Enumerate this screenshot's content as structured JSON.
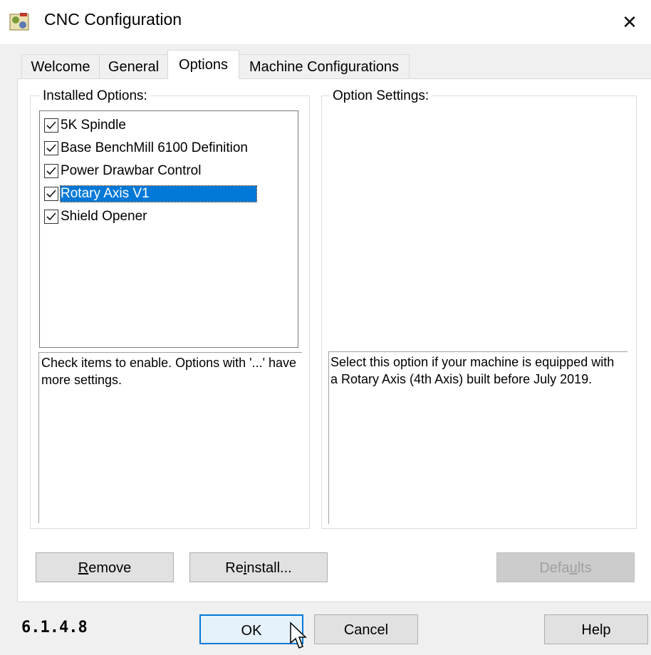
{
  "window": {
    "title": "CNC Configuration",
    "close_label": "✕",
    "icon": "cnc-app-icon"
  },
  "tabs": [
    {
      "label": "Welcome",
      "active": false
    },
    {
      "label": "General",
      "active": false
    },
    {
      "label": "Options",
      "active": true
    },
    {
      "label": "Machine Configurations",
      "active": false
    }
  ],
  "installed_options": {
    "group_label": "Installed Options:",
    "items": [
      {
        "label": "5K Spindle",
        "checked": true,
        "selected": false
      },
      {
        "label": "Base BenchMill 6100 Definition",
        "checked": true,
        "selected": false
      },
      {
        "label": "Power Drawbar Control",
        "checked": true,
        "selected": false
      },
      {
        "label": "Rotary Axis V1",
        "checked": true,
        "selected": true
      },
      {
        "label": "Shield Opener",
        "checked": true,
        "selected": false
      }
    ],
    "help_text": "Check items to enable. Options with '...' have more settings."
  },
  "option_settings": {
    "group_label": "Option Settings:",
    "description": "Select this option if your machine is equipped with a Rotary Axis (4th Axis) built before July 2019."
  },
  "buttons": {
    "remove": {
      "pre": "",
      "accel": "R",
      "post": "emove"
    },
    "reinstall": {
      "pre": "Re",
      "accel": "i",
      "post": "nstall..."
    },
    "defaults": {
      "pre": "Defa",
      "accel": "u",
      "post": "lts"
    },
    "ok": "OK",
    "cancel": "Cancel",
    "help": "Help"
  },
  "version": "6.1.4.8",
  "colors": {
    "selection": "#0078d7",
    "dialog_bg": "#f0f0f0",
    "button_bg": "#e1e1e1"
  }
}
